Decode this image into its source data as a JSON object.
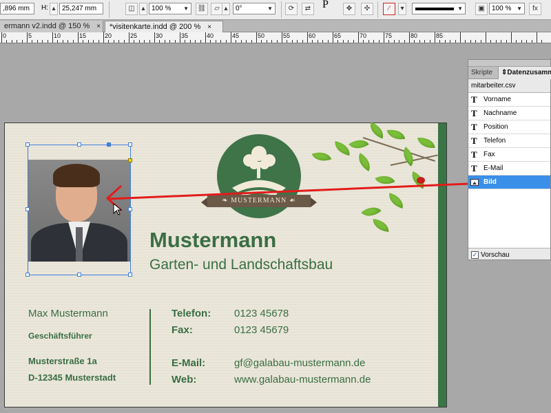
{
  "control_bar": {
    "x_value": ",896 mm",
    "h_label": "H:",
    "h_value": "25,247 mm",
    "scale_value": "100 %",
    "angle_value": "0°",
    "stroke_value": "100 %",
    "p_glyph": "P"
  },
  "tabs": [
    {
      "label": "ermann v2.indd @ 150 %"
    },
    {
      "label": "*visitenkarte.indd @ 200 %"
    }
  ],
  "tab_close": "×",
  "ruler": {
    "labels": [
      "0",
      "5",
      "10",
      "15",
      "20",
      "25",
      "30",
      "35",
      "40",
      "45",
      "50",
      "55",
      "60",
      "65",
      "70",
      "75",
      "80",
      "85"
    ]
  },
  "card": {
    "logo_text": "MUSTERMANN",
    "company_name": "Mustermann",
    "tagline": "Garten- und Landschaftsbau",
    "person_name": "Max Mustermann",
    "position": "Geschäftsführer",
    "street": "Musterstraße 1a",
    "city": "D-12345 Musterstadt",
    "contacts": [
      {
        "label": "Telefon:",
        "value": "0123 45678"
      },
      {
        "label": "Fax:",
        "value": "0123 45679"
      },
      {
        "label": "E-Mail:",
        "value": "gf@galabau-mustermann.de"
      },
      {
        "label": "Web:",
        "value": "www.galabau-mustermann.de"
      }
    ]
  },
  "panel": {
    "tab_scripts": "Skripte",
    "tab_datamerge": "Datenzusammenführung",
    "source_file": "mitarbeiter.csv",
    "fields": [
      {
        "type": "text",
        "icon": "T",
        "label": "Vorname"
      },
      {
        "type": "text",
        "icon": "T",
        "label": "Nachname"
      },
      {
        "type": "text",
        "icon": "T",
        "label": "Position"
      },
      {
        "type": "text",
        "icon": "T",
        "label": "Telefon"
      },
      {
        "type": "text",
        "icon": "T",
        "label": "Fax"
      },
      {
        "type": "text",
        "icon": "T",
        "label": "E-Mail"
      },
      {
        "type": "image",
        "icon": "",
        "label": "Bild"
      }
    ],
    "preview_label": "Vorschau",
    "preview_check": "✓"
  },
  "colors": {
    "card_green": "#3a6e43",
    "selection_blue": "#3a8fe8",
    "frame_blue": "#3d7fe0",
    "arrow_red": "#e31b1b"
  }
}
